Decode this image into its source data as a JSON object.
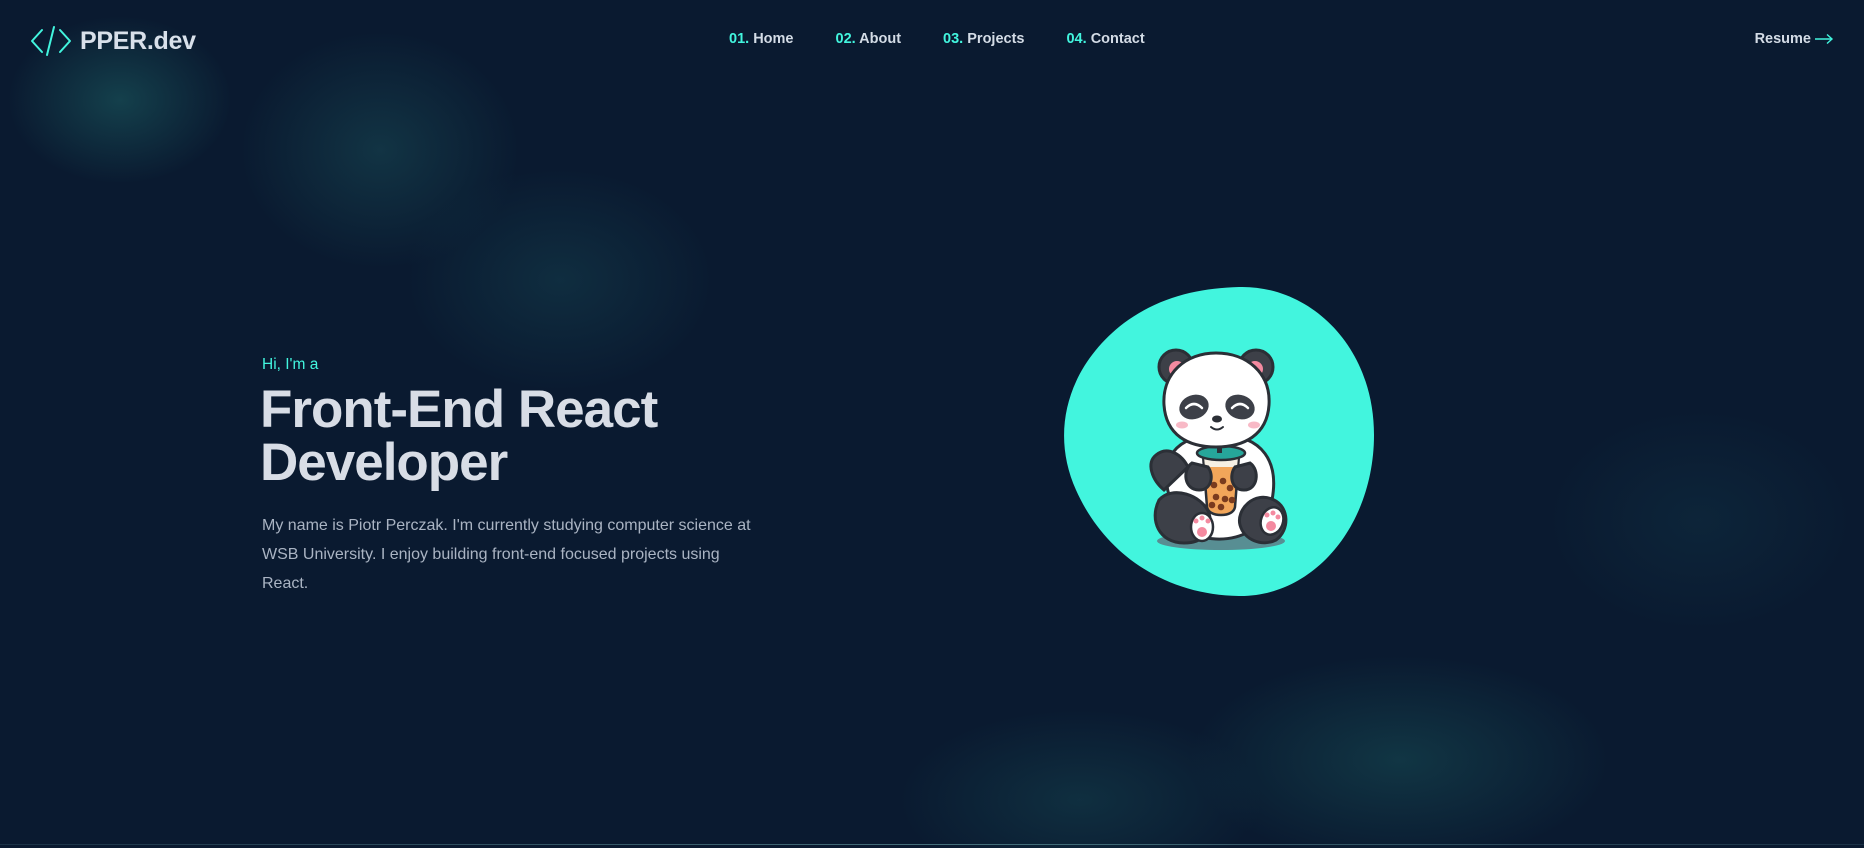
{
  "brand": {
    "logo_icon": "code-brackets-icon",
    "name": "PPER.dev",
    "accent_color": "#42f5de",
    "background_color": "#0a1a30"
  },
  "nav": {
    "items": [
      {
        "number": "01.",
        "label": "Home"
      },
      {
        "number": "02.",
        "label": "About"
      },
      {
        "number": "03.",
        "label": "Projects"
      },
      {
        "number": "04.",
        "label": "Contact"
      }
    ],
    "resume_label": "Resume",
    "resume_icon": "arrow-right-icon"
  },
  "hero": {
    "greeting": "Hi, I'm a",
    "title_line1": "Front-End React",
    "title_line2": "Developer",
    "intro": "My name is Piotr Perczak. I'm currently studying computer science at WSB University. I enjoy building front-end focused projects using React.",
    "illustration": "panda-drinking-bubble-tea-illustration"
  }
}
